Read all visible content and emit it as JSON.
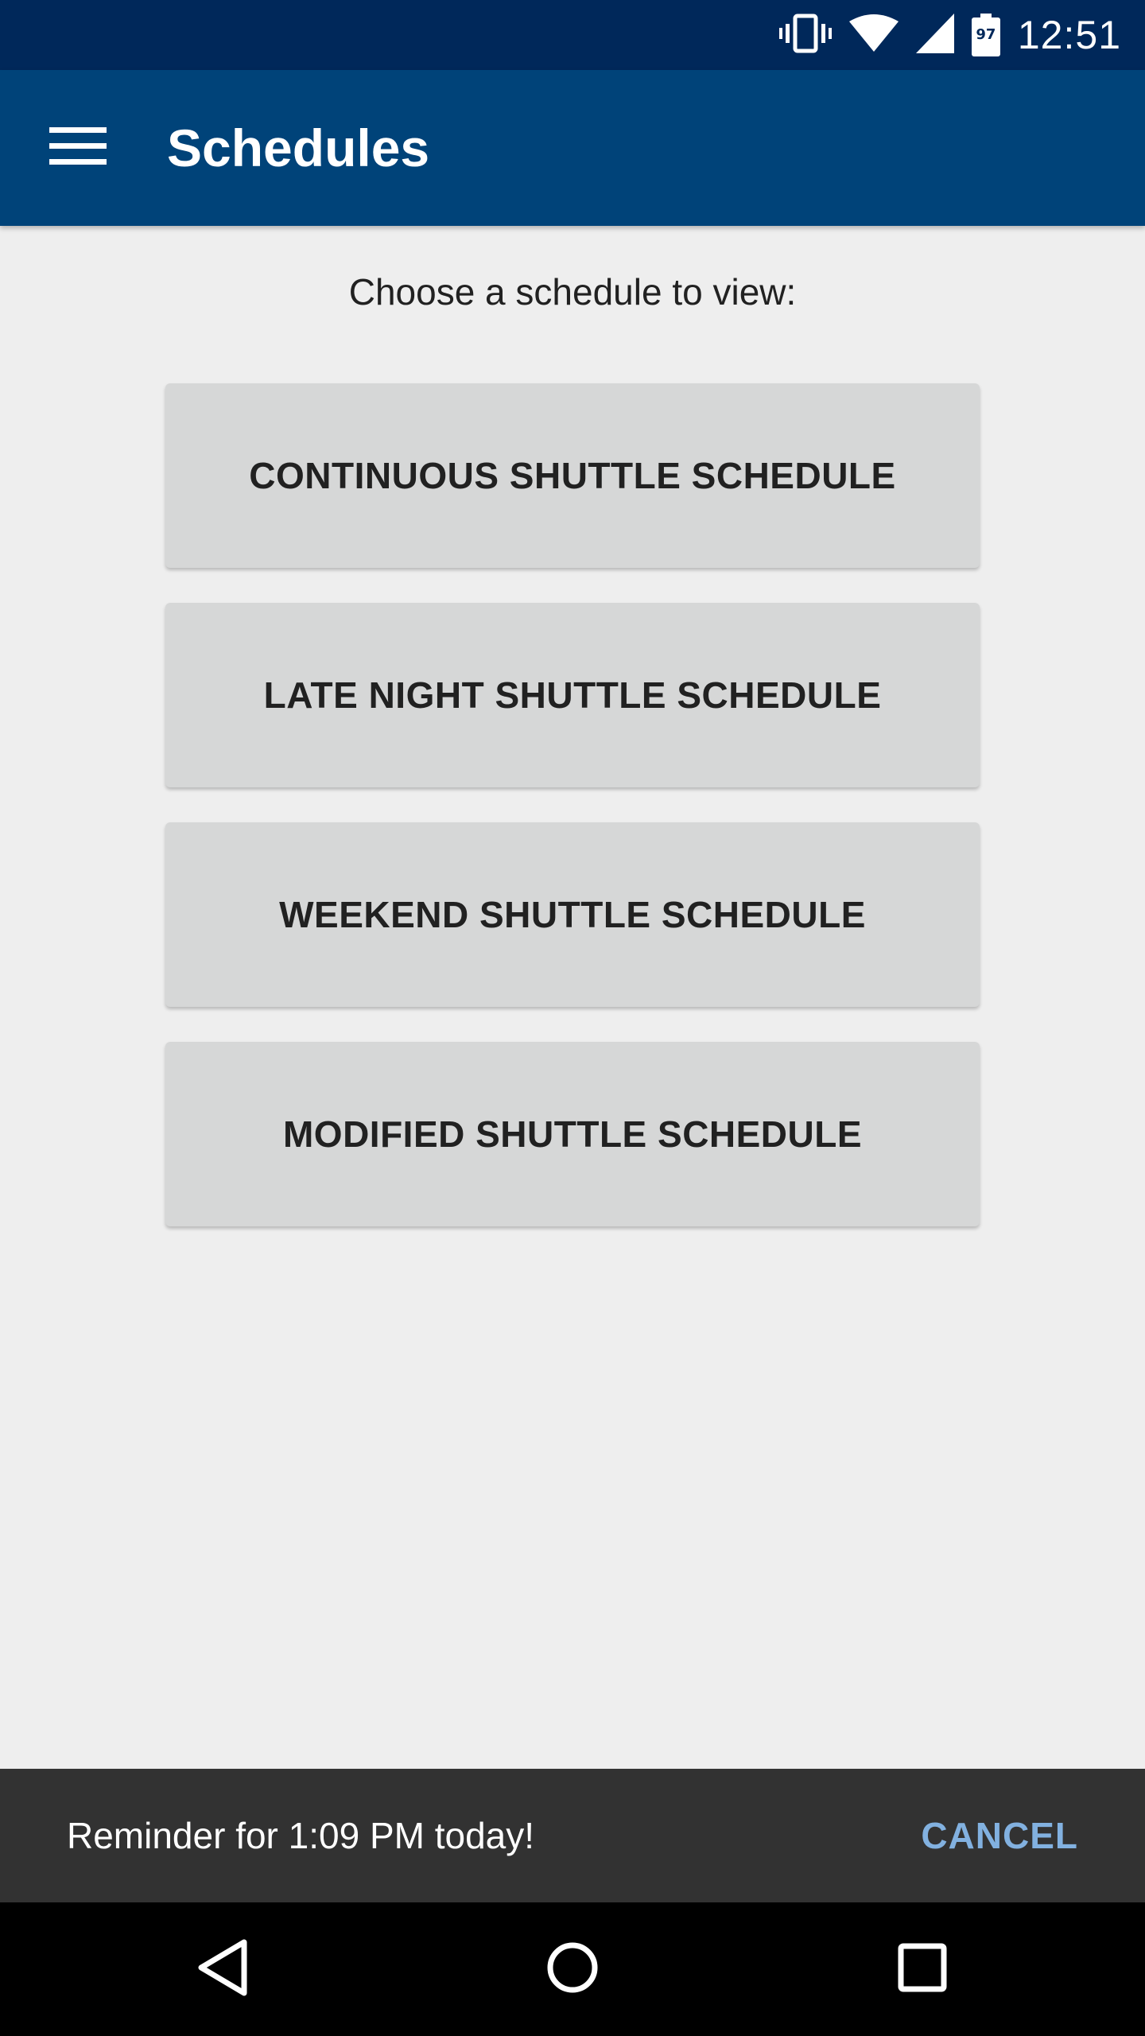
{
  "status_bar": {
    "time": "12:51",
    "battery_level": "97",
    "icons": [
      "vibrate-icon",
      "wifi-icon",
      "cell-signal-icon",
      "battery-icon"
    ]
  },
  "app_bar": {
    "title": "Schedules",
    "menu_icon": "hamburger-menu-icon"
  },
  "main": {
    "prompt": "Choose a schedule to view:",
    "buttons": [
      {
        "label": "CONTINUOUS SHUTTLE SCHEDULE"
      },
      {
        "label": "LATE NIGHT SHUTTLE SCHEDULE"
      },
      {
        "label": "WEEKEND SHUTTLE SCHEDULE"
      },
      {
        "label": "MODIFIED SHUTTLE SCHEDULE"
      }
    ]
  },
  "snackbar": {
    "message": "Reminder for 1:09 PM today!",
    "action": "CANCEL"
  },
  "nav_bar": {
    "icons": [
      "back-icon",
      "home-icon",
      "recents-icon"
    ]
  },
  "colors": {
    "status_bar": "#00285a",
    "app_bar": "#004379",
    "background": "#eeeeee",
    "button": "#d6d7d7",
    "snackbar": "#323232",
    "snackbar_action": "#82b1e0"
  }
}
